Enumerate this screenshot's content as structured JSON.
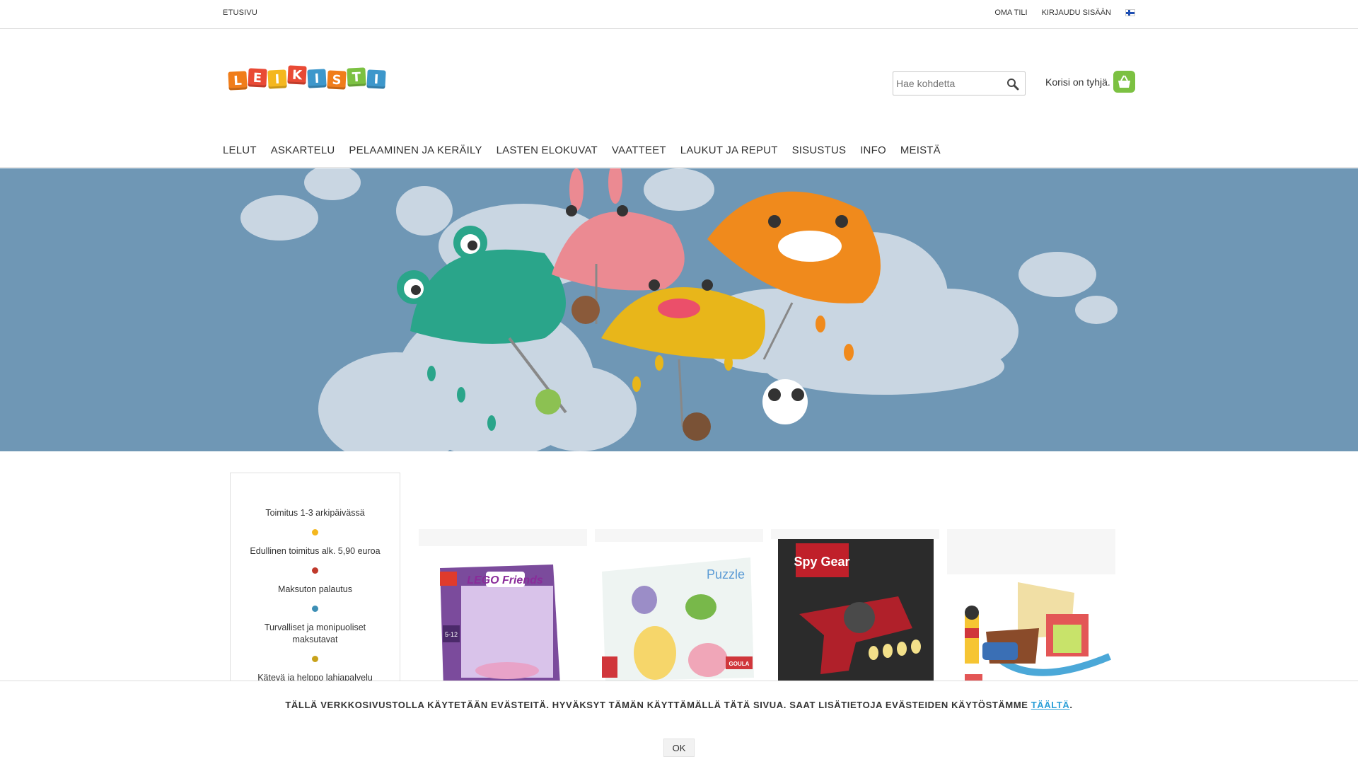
{
  "topbar": {
    "home": "ETUSIVU",
    "account": "OMA TILI",
    "login": "KIRJAUDU SISÄÄN",
    "flag_icon": "finnish-flag-icon"
  },
  "logo": {
    "letters": [
      "L",
      "E",
      "I",
      "K",
      "I",
      "S",
      "T",
      "I"
    ],
    "colors": [
      "#f07d1a",
      "#e94a35",
      "#f4b71f",
      "#e94a35",
      "#3d97cb",
      "#f07d1a",
      "#7cc142",
      "#3d97cb"
    ]
  },
  "search": {
    "placeholder": "Hae kohdetta",
    "icon": "search-icon"
  },
  "cart": {
    "text": "Korisi on tyhjä.",
    "icon": "basket-icon"
  },
  "nav": [
    "LELUT",
    "ASKARTELU",
    "PELAAMINEN JA KERÄILY",
    "LASTEN ELOKUVAT",
    "VAATTEET",
    "LAUKUT JA REPUT",
    "SISUSTUS",
    "INFO",
    "MEISTÄ"
  ],
  "usp": [
    {
      "text": "Toimitus 1-3 arkipäivässä",
      "dot": "#f4b71f"
    },
    {
      "text": "Edullinen toimitus alk. 5,90 euroa",
      "dot": "#c0392b"
    },
    {
      "text": "Maksuton palautus",
      "dot": "#3d8fb5"
    },
    {
      "text": "Turvalliset ja monipuoliset maksutavat",
      "dot": "#c8a21a"
    },
    {
      "text": "Kätevä ja helppo lahjapalvelu",
      "dot": "#f4b71f"
    }
  ],
  "products": [
    {
      "image": "LEGO Friends",
      "sublabel": "5-12"
    },
    {
      "image": "Puzzle",
      "sublabel": "GOULA"
    },
    {
      "image": "Spy Gear",
      "sublabel": ""
    },
    {
      "image": "",
      "sublabel": ""
    }
  ],
  "cookie": {
    "message": "TÄLLÄ VERKKOSIVUSTOLLA KÄYTETÄÄN EVÄSTEITÄ. HYVÄKSYT TÄMÄN KÄYTTÄMÄLLÄ TÄTÄ SIVUA. SAAT LISÄTIETOJA EVÄSTEIDEN KÄYTÖSTÄMME ",
    "link": "TÄÄLTÄ",
    "suffix": ".",
    "ok": "OK"
  }
}
